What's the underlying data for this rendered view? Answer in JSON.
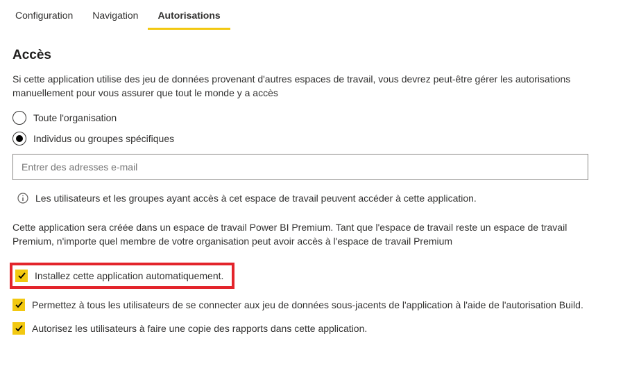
{
  "tabs": {
    "configuration": "Configuration",
    "navigation": "Navigation",
    "authorizations": "Autorisations"
  },
  "section": {
    "title": "Accès",
    "description": "Si cette application utilise des jeu de données provenant d'autres espaces de travail, vous devrez peut-être gérer les autorisations manuellement pour vous assurer que tout le monde y a accès"
  },
  "radio": {
    "entire_org": "Toute l'organisation",
    "specific": "Individus ou groupes spécifiques"
  },
  "input": {
    "placeholder": "Entrer des adresses e-mail"
  },
  "info_text": "Les utilisateurs et les groupes ayant accès à cet espace de travail peuvent accéder à cette application.",
  "premium_note": "Cette application sera créée dans un espace de travail Power BI Premium. Tant que l'espace de travail reste un espace de travail Premium, n'importe quel membre de votre organisation peut avoir accès à l'espace de travail Premium",
  "checkboxes": {
    "install_auto": "Installez cette application automatiquement.",
    "allow_build": "Permettez à tous les utilisateurs de se connecter aux jeu de données sous-jacents de l'application à l'aide de l'autorisation Build.",
    "allow_copy": "Autorisez les utilisateurs à faire une copie des rapports dans cette application."
  }
}
